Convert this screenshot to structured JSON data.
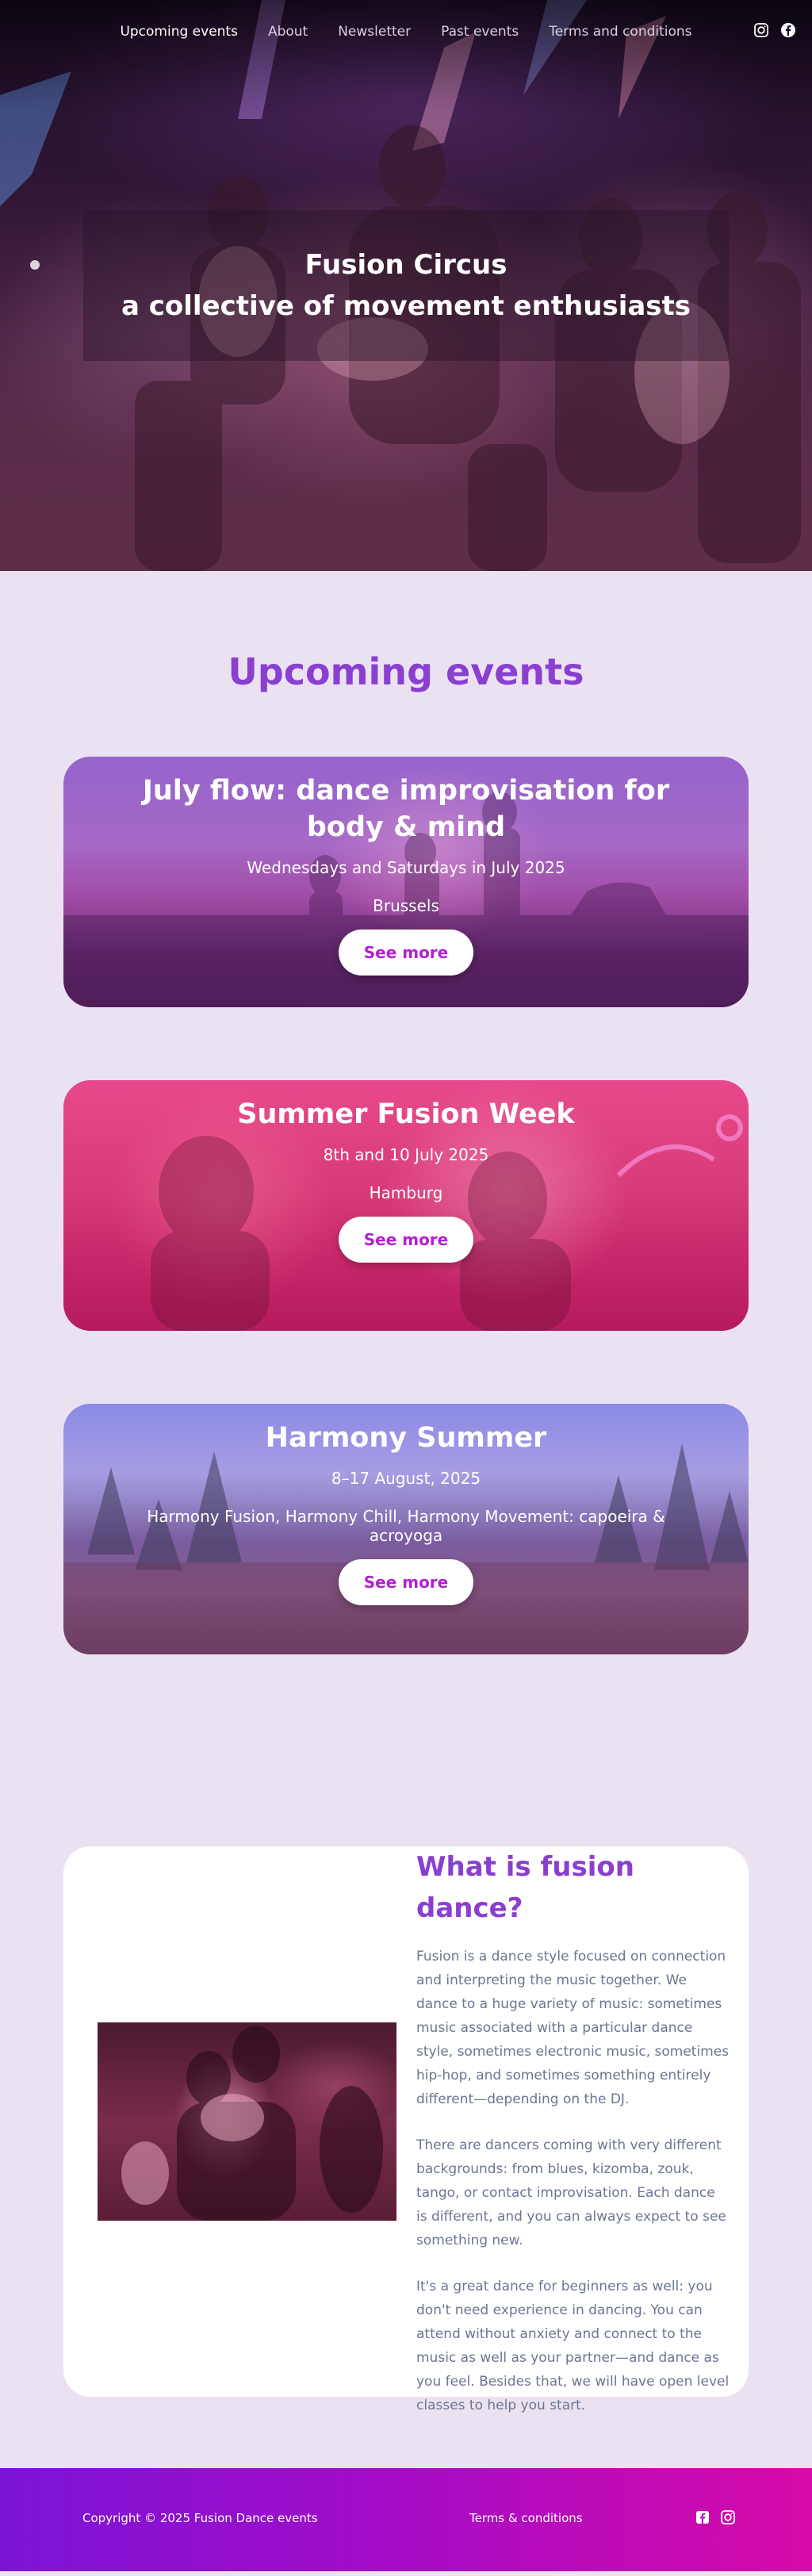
{
  "nav": {
    "items": [
      {
        "label": "Upcoming events",
        "active": true
      },
      {
        "label": "About",
        "active": false
      },
      {
        "label": "Newsletter",
        "active": false
      },
      {
        "label": "Past events",
        "active": false
      },
      {
        "label": "Terms and conditions",
        "active": false
      }
    ],
    "social_icons": [
      "instagram-icon",
      "facebook-icon"
    ]
  },
  "hero": {
    "title": "Fusion Circus",
    "subtitle": "a collective of movement enthusiasts"
  },
  "events": {
    "heading": "Upcoming events",
    "items": [
      {
        "title": "July flow: dance improvisation for body & mind",
        "date": "Wednesdays and Saturdays in July 2025",
        "location": "Brussels",
        "button": "See more"
      },
      {
        "title": "Summer Fusion Week",
        "date": "8th and 10 July 2025",
        "location": "Hamburg",
        "button": "See more"
      },
      {
        "title": "Harmony Summer",
        "date": "8–17 August, 2025",
        "location": "Harmony Fusion, Harmony Chill, Harmony Movement: capoeira & acroyoga",
        "button": "See more"
      }
    ]
  },
  "fusion": {
    "title": "What is fusion dance?",
    "paragraphs": [
      "Fusion is a dance style focused on connection and interpreting the music together. We dance to a huge variety of music: sometimes music associated with a particular dance style, sometimes electronic music, sometimes hip-hop, and sometimes something entirely different—depending on the DJ.",
      "There are dancers coming with very different backgrounds: from blues, kizomba, zouk, tango, or contact improvisation. Each dance is different, and you can always expect to see something new.",
      "It's a great dance for beginners as well: you don't need experience in dancing. You can attend without anxiety and connect to the music as well as your partner—and dance as you feel. Besides that, we will have open level classes to help you start."
    ]
  },
  "footer": {
    "copyright": "Copyright © 2025 Fusion Dance events",
    "terms": "Terms & conditions",
    "social_icons": [
      "facebook-icon",
      "instagram-icon"
    ]
  },
  "colors": {
    "accent_purple": "#8a3fd1",
    "button_text": "#b41fd2",
    "page_background": "#ebe2f1",
    "footer_gradient_start": "#7b14d6",
    "footer_gradient_end": "#d60aa8"
  }
}
